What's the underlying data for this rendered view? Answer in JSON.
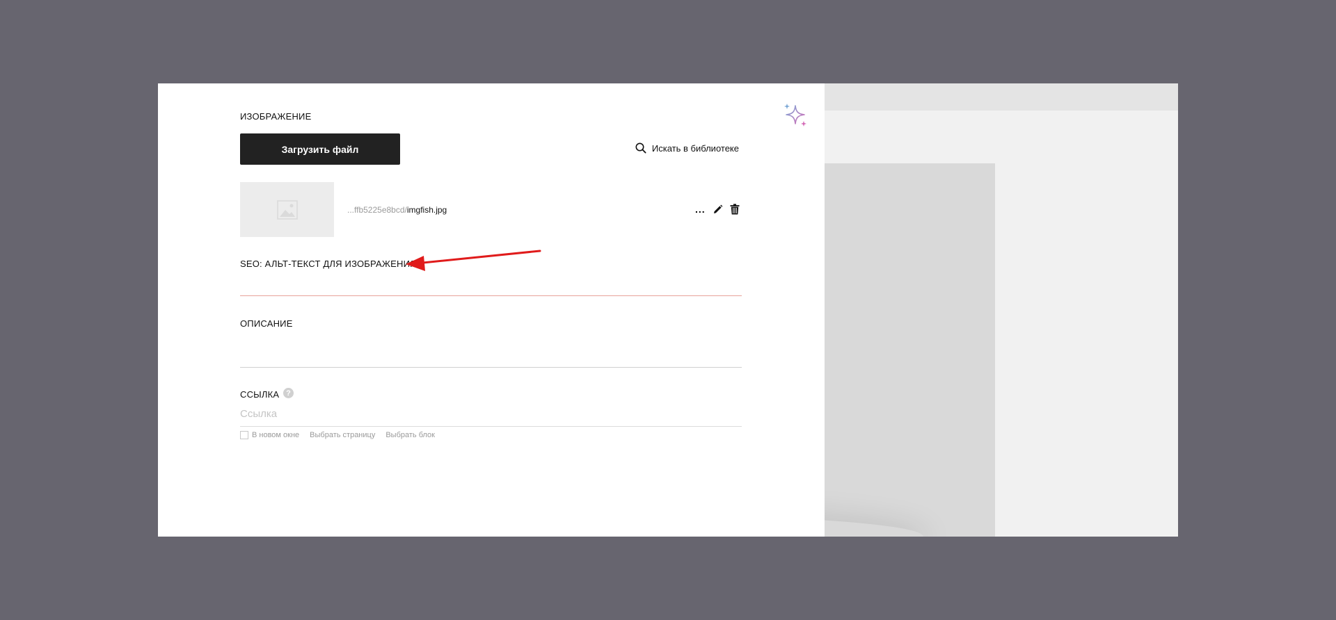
{
  "image_section": {
    "heading": "ИЗОБРАЖЕНИЕ",
    "upload_label": "Загрузить файл",
    "library_search_label": "Искать в библиотеке"
  },
  "file": {
    "path_prefix": "...ffb5225e8bcd/",
    "name": "imgfish.jpg",
    "more_label": "..."
  },
  "alt_text": {
    "label": "SEO: АЛЬТ-ТЕКСТ ДЛЯ ИЗОБРАЖЕНИЯ",
    "value": "",
    "underline_color": "#e8a29a"
  },
  "description": {
    "label": "ОПИСАНИЕ",
    "value": ""
  },
  "link": {
    "label": "ССЫЛКА",
    "help": "?",
    "placeholder": "Ссылка",
    "value": "",
    "new_window_label": "В новом окне",
    "new_window_checked": false,
    "choose_page_label": "Выбрать страницу",
    "choose_block_label": "Выбрать блок"
  },
  "icons": {
    "sparkle": "ai-sparkle-icon",
    "search": "search-icon",
    "edit": "pencil-icon",
    "delete": "trash-icon",
    "placeholder": "image-placeholder-icon"
  },
  "colors": {
    "backdrop": "#67656f",
    "button_bg": "#222222",
    "annotation_arrow": "#e01b1b",
    "sparkle_blue": "#7aa7d6",
    "sparkle_pink": "#d46ab6"
  }
}
